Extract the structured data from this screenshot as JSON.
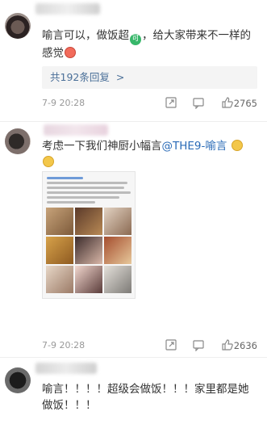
{
  "comments": [
    {
      "text_a": "喻言可以，做饭超",
      "emoji_a": "可",
      "text_b": "，给大家带来不一样的感觉",
      "reply_count": "共192条回复",
      "reply_arrow": ">",
      "time": "7-9 20:28",
      "likes": "2765"
    },
    {
      "text_a": "考虑一下我们神厨小幅言",
      "mention": "@THE9-喻言",
      "time": "7-9 20:28",
      "likes": "2636"
    },
    {
      "text_a": "喻言！！！！超级会做饭！！！家里都是她做饭！！！"
    }
  ],
  "colors": {
    "mention": "#2a6bb7",
    "reply_link": "#4a6f98",
    "meta_gray": "#999999"
  },
  "icons": [
    "share-icon",
    "comment-icon",
    "like-icon"
  ]
}
